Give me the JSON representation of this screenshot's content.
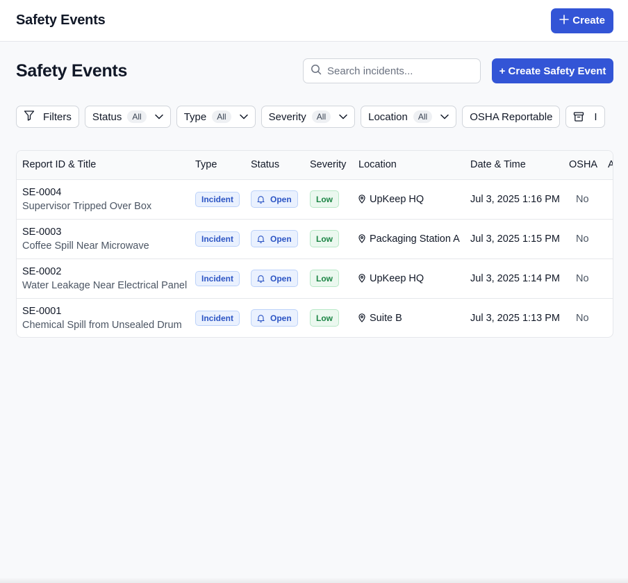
{
  "topbar": {
    "title": "Safety Events",
    "create_label": "Create"
  },
  "header": {
    "title": "Safety Events",
    "search_placeholder": "Search incidents...",
    "create_event_label": "+ Create Safety Event"
  },
  "filters": {
    "filters_label": "Filters",
    "status": {
      "label": "Status",
      "value": "All"
    },
    "type": {
      "label": "Type",
      "value": "All"
    },
    "severity": {
      "label": "Severity",
      "value": "All"
    },
    "location": {
      "label": "Location",
      "value": "All"
    },
    "osha_label": "OSHA Reportable",
    "archived_label": "I"
  },
  "table": {
    "columns": [
      "Report ID & Title",
      "Type",
      "Status",
      "Severity",
      "Location",
      "Date & Time",
      "OSHA",
      "A"
    ],
    "rows": [
      {
        "id": "SE-0004",
        "title": "Supervisor Tripped Over Box",
        "type": "Incident",
        "status": "Open",
        "severity": "Low",
        "location": "UpKeep HQ",
        "datetime": "Jul 3, 2025 1:16 PM",
        "osha": "No"
      },
      {
        "id": "SE-0003",
        "title": "Coffee Spill Near Microwave",
        "type": "Incident",
        "status": "Open",
        "severity": "Low",
        "location": "Packaging Station A",
        "datetime": "Jul 3, 2025 1:15 PM",
        "osha": "No"
      },
      {
        "id": "SE-0002",
        "title": "Water Leakage Near Electrical Panel",
        "type": "Incident",
        "status": "Open",
        "severity": "Low",
        "location": "UpKeep HQ",
        "datetime": "Jul 3, 2025 1:14 PM",
        "osha": "No"
      },
      {
        "id": "SE-0001",
        "title": "Chemical Spill from Unsealed Drum",
        "type": "Incident",
        "status": "Open",
        "severity": "Low",
        "location": "Suite B",
        "datetime": "Jul 3, 2025 1:13 PM",
        "osha": "No"
      }
    ]
  },
  "icons": {
    "plus": "plus-icon",
    "search": "search-icon",
    "filter": "filter-icon",
    "chevron": "chevron-down-icon",
    "archive": "archive-icon",
    "bell": "bell-icon",
    "pin": "map-pin-icon"
  },
  "colors": {
    "primary": "#3355d6",
    "type_badge": "#2b54c4",
    "severity_low": "#1c8545",
    "background": "#f8f9fb"
  }
}
